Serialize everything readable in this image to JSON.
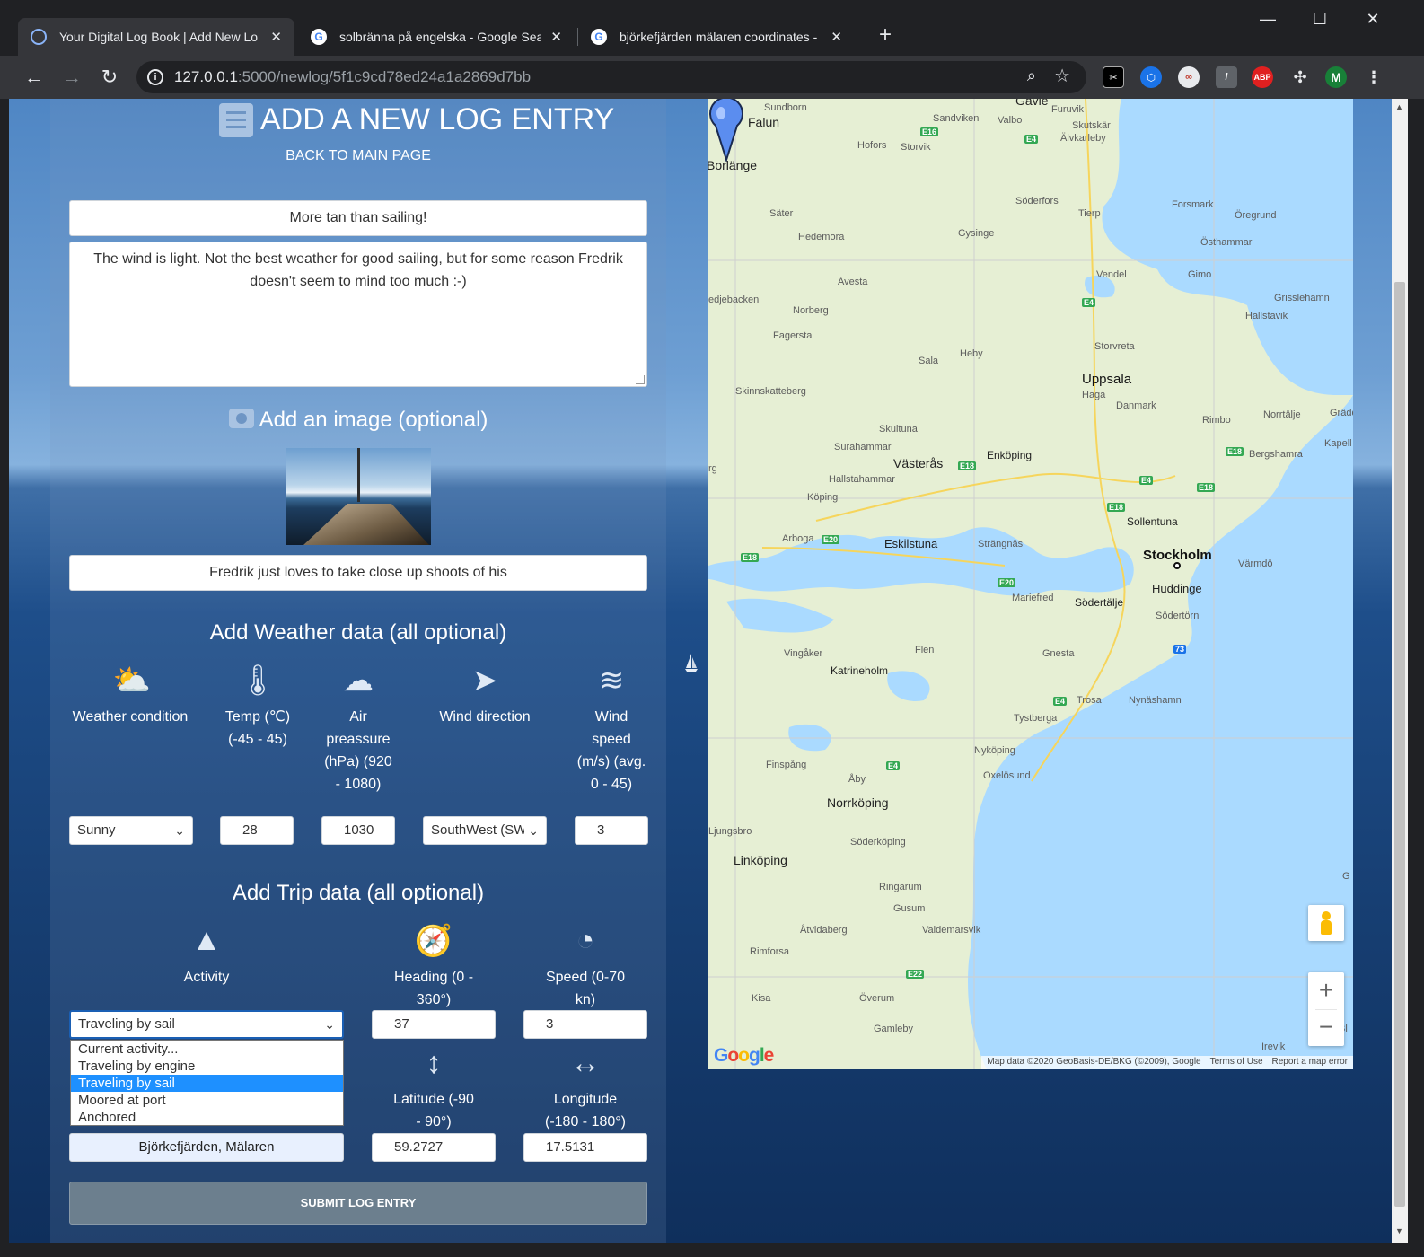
{
  "browser": {
    "tabs": [
      {
        "title": "Your Digital Log Book | Add New Lo",
        "active": true
      },
      {
        "title": "solbränna på engelska - Google Sea",
        "active": false
      },
      {
        "title": "björkefjärden mälaren coordinates -",
        "active": false
      }
    ],
    "url_host": "127.0.0.1",
    "url_rest": ":5000/newlog/5f1c9cd78ed24a1a2869d7bb",
    "profile_initial": "M",
    "abp_label": "ABP"
  },
  "page": {
    "heading": "ADD A NEW LOG ENTRY",
    "back_link": "BACK TO MAIN PAGE",
    "title_value": "More tan than sailing!",
    "description_value": "The wind is light. Not the best weather for good sailing, but for some reason Fredrik doesn't seem to mind too much :-)",
    "image_heading": "Add an image (optional)",
    "image_caption_value": "Fredrik just loves to take close up shoots of his",
    "weather_heading": "Add Weather data (all optional)",
    "weather": {
      "condition_label": "Weather condition",
      "condition_value": "Sunny",
      "temp_label": "Temp (℃) (-45 - 45)",
      "temp_value": "28",
      "pressure_label": "Air preassure (hPa) (920 - 1080)",
      "pressure_value": "1030",
      "wind_dir_label": "Wind direction",
      "wind_dir_value": "SouthWest (SW",
      "wind_speed_label": "Wind speed (m/s) (avg. 0 - 45)",
      "wind_speed_value": "3"
    },
    "trip_heading": "Add Trip data (all optional)",
    "trip": {
      "activity_label": "Activity",
      "activity_value": "Traveling by sail",
      "activity_options": [
        "Current activity...",
        "Traveling by engine",
        "Traveling by sail",
        "Moored at port",
        "Anchored"
      ],
      "heading_label": "Heading (0 - 360°)",
      "heading_value": "37",
      "speed_label": "Speed (0-70 kn)",
      "speed_value": "3",
      "latitude_label": "Latitude (-90 - 90°)",
      "latitude_value": "59.2727",
      "longitude_label": "Longitude (-180 - 180°)",
      "longitude_value": "17.5131",
      "place_value": "Björkefjärden, Mälaren"
    },
    "submit_label": "SUBMIT LOG ENTRY"
  },
  "map": {
    "labels": {
      "falun": "Falun",
      "sundborn": "Sundborn",
      "sandviken": "Sandviken",
      "valbo": "Valbo",
      "gavle": "Gävle",
      "furuvik": "Furuvik",
      "skutskar": "Skutskär",
      "alvkarleby": "Älvkarleby",
      "borlange": "Borlänge",
      "hofors": "Hofors",
      "storvik": "Storvik",
      "soderfors": "Söderfors",
      "tierp": "Tierp",
      "forsmark": "Forsmark",
      "oregrund": "Öregrund",
      "sater": "Säter",
      "hedemora": "Hedemora",
      "gysinge": "Gysinge",
      "osthammar": "Östhammar",
      "vendel": "Vendel",
      "gimo": "Gimo",
      "avesta": "Avesta",
      "grisslehamn": "Grisslehamn",
      "ludvika": "edjebacken",
      "norberg": "Norberg",
      "hallstavik": "Hallstavik",
      "fagersta": "Fagersta",
      "heby": "Heby",
      "storvreta": "Storvreta",
      "sala": "Sala",
      "skinnskatteberg": "Skinnskatteberg",
      "uppsala": "Uppsala",
      "haga": "Haga",
      "danmark": "Danmark",
      "rimbo": "Rimbo",
      "norrtalje": "Norrtälje",
      "gradd": "Grädd",
      "skultuna": "Skultuna",
      "kapell": "Kapell",
      "surahammar": "Surahammar",
      "vasteras": "Västerås",
      "enkoping": "Enköping",
      "bergshamra": "Bergshamra",
      "hallstahammar": "Hallstahammar",
      "rg": "rg",
      "koping": "Köping",
      "sollentuna": "Sollentuna",
      "arboga": "Arboga",
      "eskilstuna": "Eskilstuna",
      "strangnas": "Strängnäs",
      "stockholm": "Stockholm",
      "varmdo": "Värmdö",
      "huddinge": "Huddinge",
      "mariefred": "Mariefred",
      "sodertalje": "Södertälje",
      "sodertorn": "Södertörn",
      "vingaker": "Vingåker",
      "flen": "Flen",
      "gnesta": "Gnesta",
      "katrineholm": "Katrineholm",
      "trosa": "Trosa",
      "nynashamn": "Nynäshamn",
      "tystberga": "Tystberga",
      "nykoping": "Nyköping",
      "finspang": "Finspång",
      "oxelosund": "Oxelösund",
      "aby": "Åby",
      "norrkoping": "Norrköping",
      "ljungsbro": "Ljungsbro",
      "soderkoping": "Söderköping",
      "linkoping": "Linköping",
      "ringarum": "Ringarum",
      "gusum": "Gusum",
      "valdemarsvik": "Valdemarsvik",
      "atvidaberg": "Åtvidaberg",
      "rimforsa": "Rimforsa",
      "kisa": "Kisa",
      "overum": "Överum",
      "gamleby": "Gamleby",
      "irevik": "Irevik",
      "bl": "Bl",
      "g": "G"
    },
    "roads": {
      "e16": "E16",
      "e4": "E4",
      "e18": "E18",
      "e20": "E20",
      "e22": "E22",
      "r73": "73"
    },
    "google": "Google",
    "map_data": "Map data ©2020 GeoBasis-DE/BKG (©2009), Google",
    "terms": "Terms of Use",
    "report": "Report a map error"
  }
}
